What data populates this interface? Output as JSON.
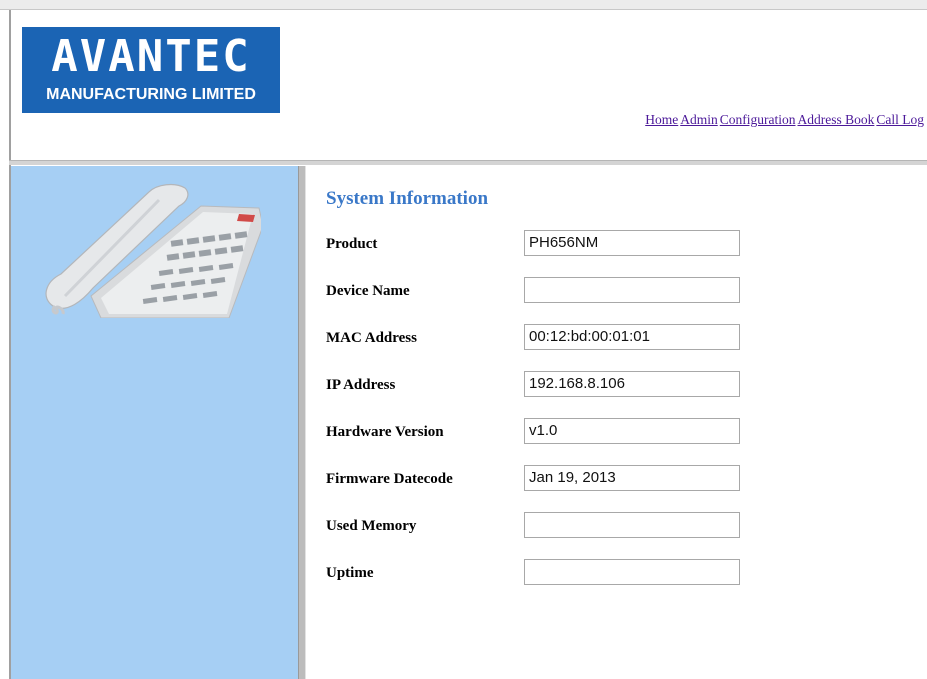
{
  "brand": {
    "logo_word": "AVANTEC",
    "logo_subtitle": "MANUFACTURING LIMITED",
    "logo_color": "#1b64b4"
  },
  "nav": {
    "home": "Home",
    "admin": "Admin",
    "configuration": "Configuration",
    "address_book": "Address Book",
    "call_log": "Call Log"
  },
  "sidebar": {
    "background": "#a6cff4",
    "image": "desk-phone-image"
  },
  "system_info": {
    "title": "System Information",
    "fields": [
      {
        "label": "Product",
        "value": ""
      },
      {
        "label": "Device Name",
        "value": ""
      },
      {
        "label": "MAC Address",
        "value": ""
      },
      {
        "label": "IP Address",
        "value": ""
      },
      {
        "label": "Hardware Version",
        "value": ""
      },
      {
        "label": "Firmware Datecode",
        "value": ""
      },
      {
        "label": "Used Memory",
        "value": ""
      },
      {
        "label": "Uptime",
        "value": ""
      }
    ],
    "product": "PH656NM",
    "device_name": "",
    "mac_address": "00:12:bd:00:01:01",
    "ip_address": "192.168.8.106",
    "hardware_version": "v1.0",
    "firmware_datecode": "Jan 19, 2013",
    "used_memory": "",
    "uptime": ""
  }
}
